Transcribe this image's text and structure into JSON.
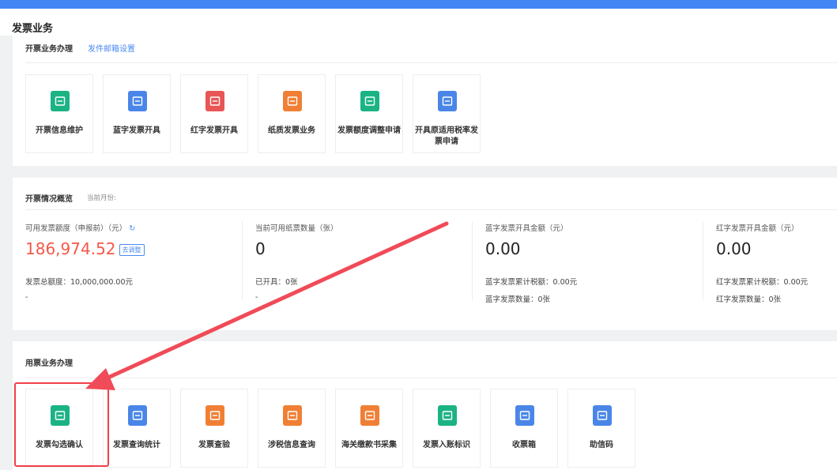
{
  "page_title": "发票业务",
  "issue_section": {
    "title": "开票业务办理",
    "link": "发件邮箱设置",
    "tiles": [
      {
        "label": "开票信息维护",
        "color": "#1bb384",
        "icon": "edit-ticket-icon"
      },
      {
        "label": "蓝字发票开具",
        "color": "#4a86e8",
        "icon": "ticket-arrow-right-icon"
      },
      {
        "label": "红字发票开具",
        "color": "#e85656",
        "icon": "ticket-arrow-left-icon"
      },
      {
        "label": "纸质发票业务",
        "color": "#f07f35",
        "icon": "paper-ticket-icon"
      },
      {
        "label": "发票额度调整申请",
        "color": "#1bb384",
        "icon": "quota-edit-icon"
      },
      {
        "label": "开具原适用税率发票申请",
        "color": "#4a86e8",
        "icon": "notepad-edit-icon"
      }
    ]
  },
  "overview": {
    "title": "开票情况概览",
    "month_label": "当前月份:",
    "stats": [
      {
        "title": "可用发票额度（申报前）（元）",
        "value": "186,974.52",
        "badge": "去调整",
        "line1": "发票总额度：10,000,000.00元",
        "line2": "-"
      },
      {
        "title": "当前可用纸票数量（张）",
        "value": "0",
        "line1": "已开具：0张",
        "line2": "-"
      },
      {
        "title": "蓝字发票开具金额（元）",
        "value": "0.00",
        "line1": "蓝字发票累计税额：0.00元",
        "line2": "蓝字发票数量：0张"
      },
      {
        "title": "红字发票开具金额（元）",
        "value": "0.00",
        "line1": "红字发票累计税额：0.00元",
        "line2": "红字发票数量：0张"
      }
    ]
  },
  "use_section": {
    "title": "用票业务办理",
    "tiles": [
      {
        "label": "发票勾选确认",
        "color": "#1bb384",
        "icon": "ticket-check-icon"
      },
      {
        "label": "发票查询统计",
        "color": "#4a86e8",
        "icon": "search-doc-icon"
      },
      {
        "label": "发票查验",
        "color": "#f07f35",
        "icon": "shield-ticket-icon"
      },
      {
        "label": "涉税信息查询",
        "color": "#f07f35",
        "icon": "folder-search-icon"
      },
      {
        "label": "海关缴款书采集",
        "color": "#f07f35",
        "icon": "anchor-doc-icon"
      },
      {
        "label": "发票入账标识",
        "color": "#1bb384",
        "icon": "ticket-down-icon"
      },
      {
        "label": "收票箱",
        "color": "#4a86e8",
        "icon": "mailbox-icon"
      },
      {
        "label": "助信码",
        "color": "#4a86e8",
        "icon": "qrcode-icon"
      }
    ]
  },
  "colors": {
    "accent": "#4286f5",
    "highlight": "#f0404a",
    "amount": "#f5584a"
  }
}
